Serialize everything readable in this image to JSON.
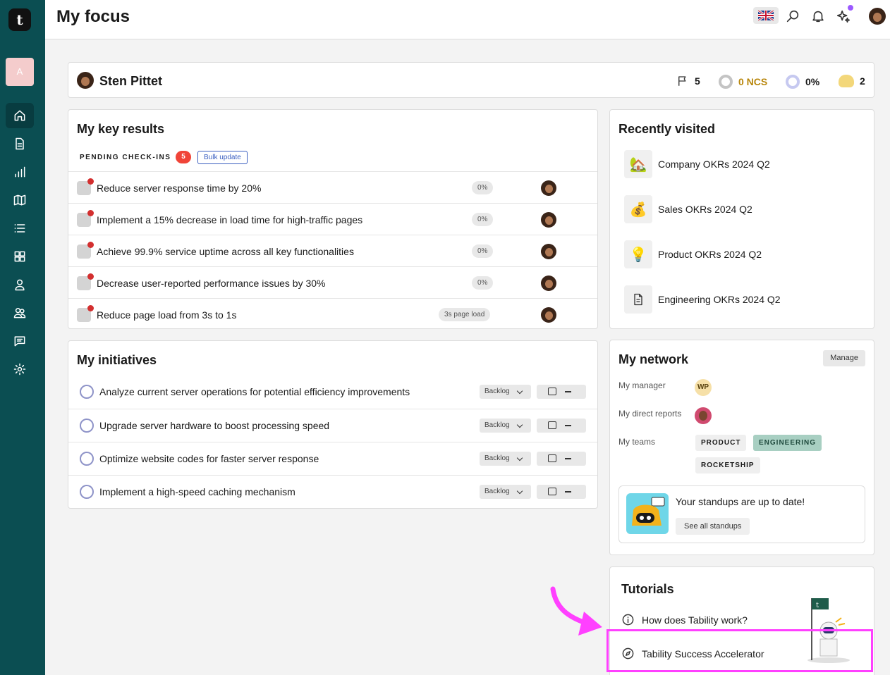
{
  "page_title": "My focus",
  "sidebar": {
    "workspace_initial": "A"
  },
  "profile": {
    "name": "Sten Pittet",
    "flags": "5",
    "ncs": "0 NCS",
    "progress": "0%",
    "coins": "2"
  },
  "key_results": {
    "title": "My key results",
    "pending_label": "PENDING CHECK-INS",
    "pending_count": "5",
    "bulk_update": "Bulk update",
    "items": [
      {
        "text": "Reduce server response time by 20%",
        "value": "0%"
      },
      {
        "text": "Implement a 15% decrease in load time for high-traffic pages",
        "value": "0%"
      },
      {
        "text": "Achieve 99.9% service uptime across all key functionalities",
        "value": "0%"
      },
      {
        "text": "Decrease user-reported performance issues by 30%",
        "value": "0%"
      },
      {
        "text": "Reduce page load from 3s to 1s",
        "value": "3s page load"
      }
    ]
  },
  "initiatives": {
    "title": "My initiatives",
    "status": "Backlog",
    "items": [
      {
        "text": "Analyze current server operations for potential efficiency improvements"
      },
      {
        "text": "Upgrade server hardware to boost processing speed"
      },
      {
        "text": "Optimize website codes for faster server response"
      },
      {
        "text": "Implement a high-speed caching mechanism"
      }
    ]
  },
  "recently_visited": {
    "title": "Recently visited",
    "items": [
      {
        "label": "Company OKRs 2024 Q2",
        "icon": "🏡"
      },
      {
        "label": "Sales OKRs 2024 Q2",
        "icon": "💰"
      },
      {
        "label": "Product OKRs 2024 Q2",
        "icon": "💡"
      },
      {
        "label": "Engineering OKRs 2024 Q2",
        "icon": "document-icon"
      }
    ]
  },
  "network": {
    "title": "My network",
    "manage": "Manage",
    "manager_label": "My manager",
    "manager_initials": "WP",
    "reports_label": "My direct reports",
    "teams_label": "My teams",
    "teams": [
      "PRODUCT",
      "ENGINEERING",
      "ROCKETSHIP"
    ],
    "standup_text": "Your standups are up to date!",
    "see_standups": "See all standups"
  },
  "tutorials": {
    "title": "Tutorials",
    "items": [
      {
        "label": "How does Tability work?"
      },
      {
        "label": "Tability Success Accelerator"
      }
    ]
  },
  "colors": {
    "sidebar": "#0b4e52",
    "accent_red": "#f04438",
    "highlight": "#ff40ff",
    "engineering_tag": "#a8cfc2"
  }
}
